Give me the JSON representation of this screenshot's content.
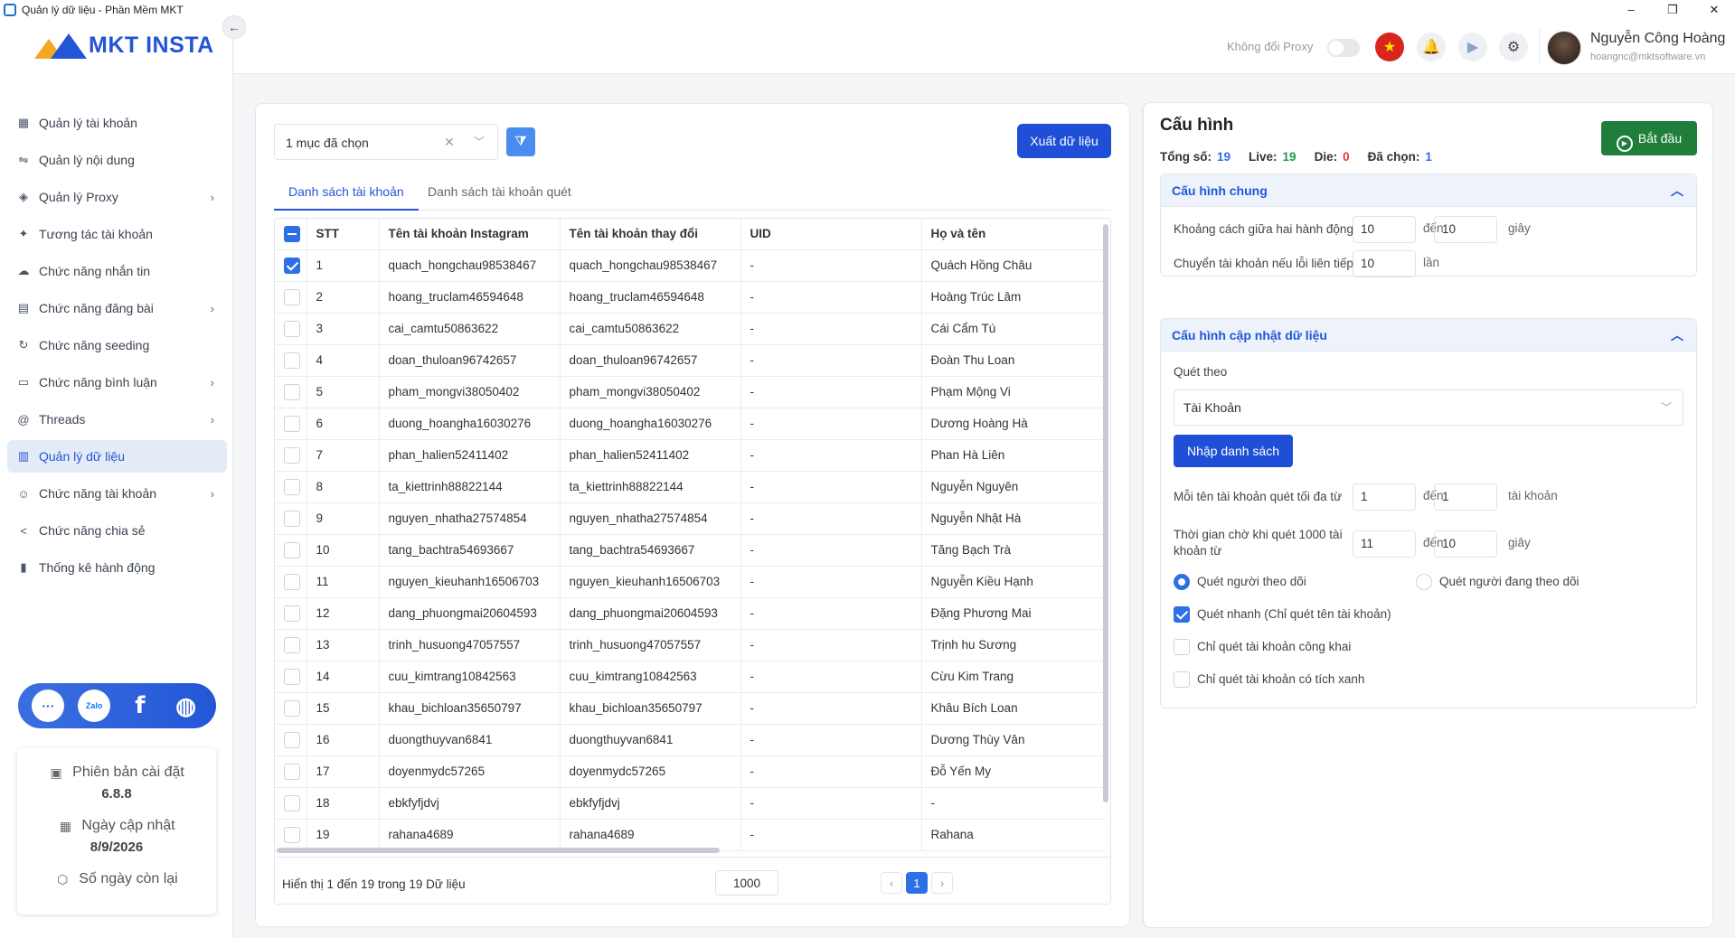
{
  "window": {
    "title": "Quản lý dữ liệu - Phần Mềm MKT",
    "minimize": "–",
    "maximize": "❐",
    "close": "✕"
  },
  "logo": {
    "text": "MKT INSTA"
  },
  "sidebar": {
    "items": [
      {
        "label": "Quản lý tài khoản",
        "icon": "grid-icon",
        "glyph": "▦",
        "chevron": false
      },
      {
        "label": "Quản lý nội dung",
        "icon": "content-icon",
        "glyph": "⇋",
        "chevron": false
      },
      {
        "label": "Quản lý Proxy",
        "icon": "layers-icon",
        "glyph": "◈",
        "chevron": true
      },
      {
        "label": "Tương tác tài khoản",
        "icon": "interaction-icon",
        "glyph": "✦",
        "chevron": false
      },
      {
        "label": "Chức năng nhắn tin",
        "icon": "chat-icon",
        "glyph": "☁",
        "chevron": false
      },
      {
        "label": "Chức năng đăng bài",
        "icon": "post-icon",
        "glyph": "▤",
        "chevron": true
      },
      {
        "label": "Chức năng seeding",
        "icon": "seeding-icon",
        "glyph": "↻",
        "chevron": false
      },
      {
        "label": "Chức năng bình luận",
        "icon": "comment-icon",
        "glyph": "▭",
        "chevron": true
      },
      {
        "label": "Threads",
        "icon": "threads-icon",
        "glyph": "@",
        "chevron": true
      },
      {
        "label": "Quản lý dữ liệu",
        "icon": "data-icon",
        "glyph": "▥",
        "chevron": false,
        "active": true
      },
      {
        "label": "Chức năng tài khoản",
        "icon": "user-icon",
        "glyph": "☺",
        "chevron": true
      },
      {
        "label": "Chức năng chia sẻ",
        "icon": "share-icon",
        "glyph": "<",
        "chevron": false
      },
      {
        "label": "Thống kê hành động",
        "icon": "stats-icon",
        "glyph": "▮",
        "chevron": false
      }
    ],
    "social": {
      "support": "···",
      "zalo": "Zalo",
      "facebook": "f",
      "web": "◍"
    },
    "version_card": {
      "version_label": "Phiên bản cài đặt",
      "version_value": "6.8.8",
      "update_label": "Ngày cập nhật",
      "update_value": "8/9/2026",
      "days_left_label": "Số ngày còn lại"
    }
  },
  "header": {
    "proxy_label": "Không đổi Proxy",
    "proxy_toggle": false,
    "user_name": "Nguyễn Công Hoàng",
    "user_email": "hoangnc@mktsoftware.vn"
  },
  "toolbar": {
    "selection_value": "1 mục đã chọn",
    "export_label": "Xuất dữ liệu"
  },
  "tabs": [
    {
      "label": "Danh sách tài khoản",
      "active": true
    },
    {
      "label": "Danh sách tài khoản quét",
      "active": false
    }
  ],
  "table": {
    "columns": [
      "STT",
      "Tên tài khoản Instagram",
      "Tên tài khoản thay đổi",
      "UID",
      "Họ và tên"
    ],
    "rows": [
      {
        "stt": "1",
        "ig": "quach_hongchau98538467",
        "changed": "quach_hongchau98538467",
        "uid": "-",
        "name": "Quách Hồng Châu",
        "checked": true
      },
      {
        "stt": "2",
        "ig": "hoang_truclam46594648",
        "changed": "hoang_truclam46594648",
        "uid": "-",
        "name": "Hoàng Trúc Lâm",
        "checked": false
      },
      {
        "stt": "3",
        "ig": "cai_camtu50863622",
        "changed": "cai_camtu50863622",
        "uid": "-",
        "name": "Cái Cẩm Tú",
        "checked": false
      },
      {
        "stt": "4",
        "ig": "doan_thuloan96742657",
        "changed": "doan_thuloan96742657",
        "uid": "-",
        "name": "Đoàn Thu Loan",
        "checked": false
      },
      {
        "stt": "5",
        "ig": "pham_mongvi38050402",
        "changed": "pham_mongvi38050402",
        "uid": "-",
        "name": "Phạm Mộng Vi",
        "checked": false
      },
      {
        "stt": "6",
        "ig": "duong_hoangha16030276",
        "changed": "duong_hoangha16030276",
        "uid": "-",
        "name": "Dương Hoàng Hà",
        "checked": false
      },
      {
        "stt": "7",
        "ig": "phan_halien52411402",
        "changed": "phan_halien52411402",
        "uid": "-",
        "name": "Phan Hà Liên",
        "checked": false
      },
      {
        "stt": "8",
        "ig": "ta_kiettrinh88822144",
        "changed": "ta_kiettrinh88822144",
        "uid": "-",
        "name": "Nguyễn Nguyên",
        "checked": false
      },
      {
        "stt": "9",
        "ig": "nguyen_nhatha27574854",
        "changed": "nguyen_nhatha27574854",
        "uid": "-",
        "name": "Nguyễn Nhật Hà",
        "checked": false
      },
      {
        "stt": "10",
        "ig": "tang_bachtra54693667",
        "changed": "tang_bachtra54693667",
        "uid": "-",
        "name": "Tăng Bạch Trà",
        "checked": false
      },
      {
        "stt": "11",
        "ig": "nguyen_kieuhanh16506703",
        "changed": "nguyen_kieuhanh16506703",
        "uid": "-",
        "name": "Nguyễn Kiều Hạnh",
        "checked": false
      },
      {
        "stt": "12",
        "ig": "dang_phuongmai20604593",
        "changed": "dang_phuongmai20604593",
        "uid": "-",
        "name": "Đặng Phương Mai",
        "checked": false
      },
      {
        "stt": "13",
        "ig": "trinh_husuong47057557",
        "changed": "trinh_husuong47057557",
        "uid": "-",
        "name": "Trịnh hu Sương",
        "checked": false
      },
      {
        "stt": "14",
        "ig": "cuu_kimtrang10842563",
        "changed": "cuu_kimtrang10842563",
        "uid": "-",
        "name": "Cừu Kim Trang",
        "checked": false
      },
      {
        "stt": "15",
        "ig": "khau_bichloan35650797",
        "changed": "khau_bichloan35650797",
        "uid": "-",
        "name": "Khâu Bích Loan",
        "checked": false
      },
      {
        "stt": "16",
        "ig": "duongthuyvan6841",
        "changed": "duongthuyvan6841",
        "uid": "-",
        "name": "Dương Thùy Vân",
        "checked": false
      },
      {
        "stt": "17",
        "ig": "doyenmydc57265",
        "changed": "doyenmydc57265",
        "uid": "-",
        "name": "Đỗ Yến My",
        "checked": false
      },
      {
        "stt": "18",
        "ig": "ebkfyfjdvj",
        "changed": "ebkfyfjdvj",
        "uid": "-",
        "name": "-",
        "checked": false
      },
      {
        "stt": "19",
        "ig": "rahana4689",
        "changed": "rahana4689",
        "uid": "-",
        "name": "Rahana",
        "checked": false
      }
    ],
    "footer_text": "Hiển thị 1 đến 19 trong 19 Dữ liệu",
    "page_size": "1000",
    "current_page": "1",
    "prev": "‹",
    "next": "›"
  },
  "config": {
    "title": "Cấu hình",
    "stats": {
      "total_label": "Tổng số:",
      "total": "19",
      "live_label": "Live:",
      "live": "19",
      "die_label": "Die:",
      "die": "0",
      "selected_label": "Đã chọn:",
      "selected": "1"
    },
    "start_label": "Bắt đầu",
    "general": {
      "title": "Cấu hình chung",
      "delay_label": "Khoảng cách giữa hai hành động",
      "delay_from": "10",
      "delay_to": "10",
      "to_word": "đến",
      "sec_unit": "giây",
      "switch_label": "Chuyển tài khoản nếu lỗi liên tiếp",
      "switch_value": "10",
      "times_unit": "lần"
    },
    "update": {
      "title": "Cấu hình cập nhật dữ liệu",
      "scan_by_label": "Quét theo",
      "scan_by_value": "Tài Khoản",
      "import_label": "Nhập danh sách",
      "max_label": "Mỗi tên tài khoản quét tối đa từ",
      "max_from": "1",
      "max_to": "1",
      "account_unit": "tài khoản",
      "wait_label": "Thời gian chờ khi quét 1000 tài khoản từ",
      "wait_from": "11",
      "wait_to": "10",
      "radio_followers": "Quét người theo dõi",
      "radio_following": "Quét người đang theo dõi",
      "fast_scan": "Quét nhanh (Chỉ quét tên tài khoản)",
      "public_only": "Chỉ quét tài khoản công khai",
      "verified_only": "Chỉ quét tài khoản có tích xanh"
    }
  }
}
